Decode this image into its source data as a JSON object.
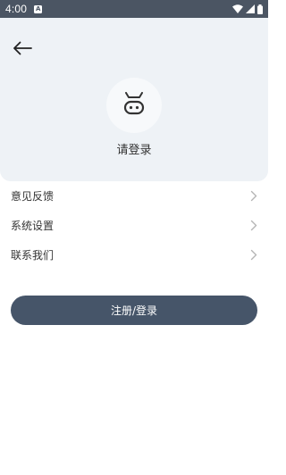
{
  "status_bar": {
    "time": "4:00",
    "notification_icon": "a-notification-icon",
    "icons": [
      "wifi-icon",
      "signal-icon",
      "battery-icon"
    ]
  },
  "header": {
    "back_icon": "arrow-left-icon",
    "avatar_icon": "cow-face-icon",
    "login_prompt": "请登录"
  },
  "menu": {
    "items": [
      {
        "label": "意见反馈",
        "icon": "chevron-right-icon"
      },
      {
        "label": "系统设置",
        "icon": "chevron-right-icon"
      },
      {
        "label": "联系我们",
        "icon": "chevron-right-icon"
      }
    ]
  },
  "actions": {
    "register_login_label": "注册/登录"
  },
  "colors": {
    "status_bar": "#4b5563",
    "header_bg": "#eef2f6",
    "primary_button": "#465569"
  }
}
